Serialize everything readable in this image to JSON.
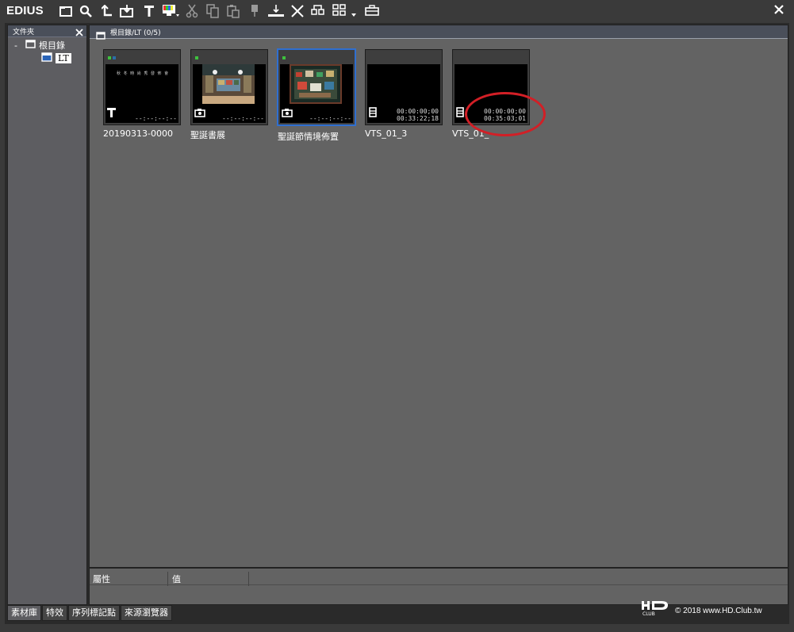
{
  "app": {
    "title": "EDIUS"
  },
  "toolbar": {
    "icons": [
      "folder-icon",
      "search-icon",
      "up-level-icon",
      "import-icon",
      "title-icon",
      "color-bar-icon",
      "cut-icon",
      "copy-icon",
      "paste-icon",
      "add-to-timeline-icon",
      "insert-to-timeline-icon",
      "delete-icon",
      "properties-icon",
      "view-icon",
      "tool-icon"
    ]
  },
  "folder_panel": {
    "header": "文件夾",
    "tree": {
      "root_toggle": "-",
      "root_label": "根目錄",
      "child_label": "LT"
    }
  },
  "bin": {
    "header": "根目錄/LT (0/5)",
    "clips": [
      {
        "name": "20190313-0000",
        "type": "title-icon",
        "tc_in": "--:--:--:--",
        "tc_out": "",
        "dots": [
          "#3ec23e",
          "#2a6ea8"
        ],
        "thumb_text": "秋 冬 時 尚 秀 發 佈 會",
        "selected": false
      },
      {
        "name": "聖誕書展",
        "type": "camera-icon",
        "tc_in": "--:--:--:--",
        "tc_out": "",
        "dots": [
          "#3ec23e"
        ],
        "thumb_text": "",
        "selected": false
      },
      {
        "name": "聖誕節情境佈置",
        "type": "camera-icon",
        "tc_in": "--:--:--:--",
        "tc_out": "",
        "dots": [
          "#3ec23e"
        ],
        "thumb_text": "",
        "selected": true
      },
      {
        "name": "VTS_01_3",
        "type": "film-icon",
        "tc_in": "00:00:00;00",
        "tc_out": "00:33:22;18",
        "dots": [],
        "thumb_text": "",
        "selected": false
      },
      {
        "name": "VTS_01_",
        "type": "film-icon",
        "tc_in": "00:00:00;00",
        "tc_out": "00:35:03;01",
        "dots": [],
        "thumb_text": "",
        "selected": false
      }
    ]
  },
  "properties": {
    "col_property": "屬性",
    "col_value": "值"
  },
  "tabs": [
    {
      "label": "素材庫",
      "active": true
    },
    {
      "label": "特效",
      "active": false
    },
    {
      "label": "序列標記點",
      "active": false
    },
    {
      "label": "來源瀏覽器",
      "active": false
    }
  ],
  "footer": {
    "copyright": "© 2018 www.HD.Club.tw"
  },
  "colors": {
    "selection_border": "#2f6fd0",
    "annotation_circle": "#d21f26"
  }
}
